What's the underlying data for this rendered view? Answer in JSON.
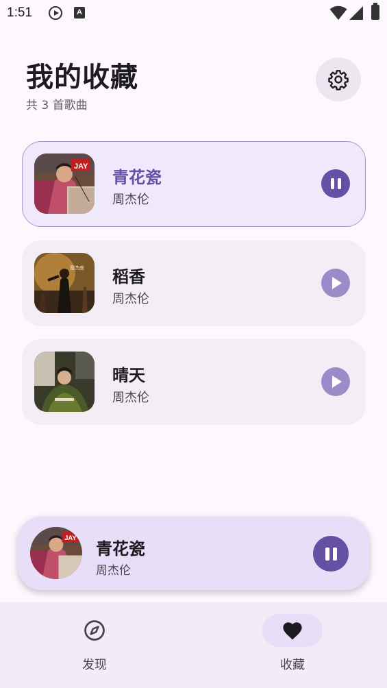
{
  "status_bar": {
    "time": "1:51",
    "icons": [
      "play-circle-icon",
      "a-notification-icon",
      "wifi-icon",
      "signal-icon",
      "battery-icon"
    ]
  },
  "header": {
    "title": "我的收藏",
    "subtitle": "共 3 首歌曲",
    "settings_icon": "gear-icon"
  },
  "songs": [
    {
      "title": "青花瓷",
      "artist": "周杰伦",
      "state": "playing",
      "button_icon": "pause-icon"
    },
    {
      "title": "稻香",
      "artist": "周杰伦",
      "state": "idle",
      "button_icon": "play-icon"
    },
    {
      "title": "晴天",
      "artist": "周杰伦",
      "state": "idle",
      "button_icon": "play-icon"
    }
  ],
  "mini_player": {
    "title": "青花瓷",
    "artist": "周杰伦",
    "button_icon": "pause-icon"
  },
  "bottom_nav": {
    "items": [
      {
        "label": "发现",
        "icon": "compass-icon",
        "selected": false
      },
      {
        "label": "收藏",
        "icon": "heart-icon",
        "selected": true
      }
    ]
  },
  "colors": {
    "background": "#fdf7fe",
    "accent": "#6650a4",
    "accent_light": "#9d8ac9",
    "active_card": "#f0e8fb",
    "card": "#f3eef5",
    "mini_player": "#e8def8",
    "nav_bar": "#f2ecf6"
  }
}
